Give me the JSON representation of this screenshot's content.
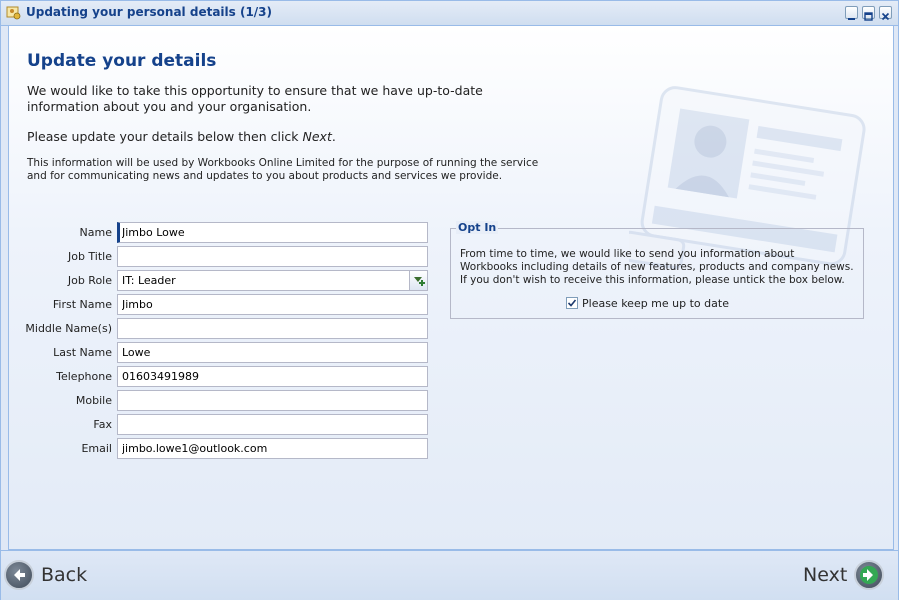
{
  "window": {
    "title": "Updating your personal details (1/3)"
  },
  "header": {
    "title": "Update your details",
    "intro": "We would like to take this opportunity to ensure that we have up-to-date information about you and your organisation.",
    "instruction_prefix": "Please update your details below then click ",
    "instruction_link": "Next",
    "instruction_suffix": ".",
    "note": "This information will be used by Workbooks Online Limited for the purpose of running the service and for communicating news and updates to you about products and services we provide."
  },
  "form": {
    "fields": [
      {
        "label": "Name",
        "value": "Jimbo Lowe"
      },
      {
        "label": "Job Title",
        "value": ""
      },
      {
        "label": "Job Role",
        "value": "IT: Leader"
      },
      {
        "label": "First Name",
        "value": "Jimbo"
      },
      {
        "label": "Middle Name(s)",
        "value": ""
      },
      {
        "label": "Last Name",
        "value": "Lowe"
      },
      {
        "label": "Telephone",
        "value": "01603491989"
      },
      {
        "label": "Mobile",
        "value": ""
      },
      {
        "label": "Fax",
        "value": ""
      },
      {
        "label": "Email",
        "value": "jimbo.lowe1@outlook.com"
      }
    ]
  },
  "opt_in": {
    "legend": "Opt In",
    "text": "From time to time, we would like to send you information about Workbooks including details of new features, products and company news. If you don't wish to receive this information, please untick the box below.",
    "checkbox_label": "Please keep me up to date",
    "checked": true
  },
  "footer": {
    "back_label": "Back",
    "next_label": "Next"
  }
}
